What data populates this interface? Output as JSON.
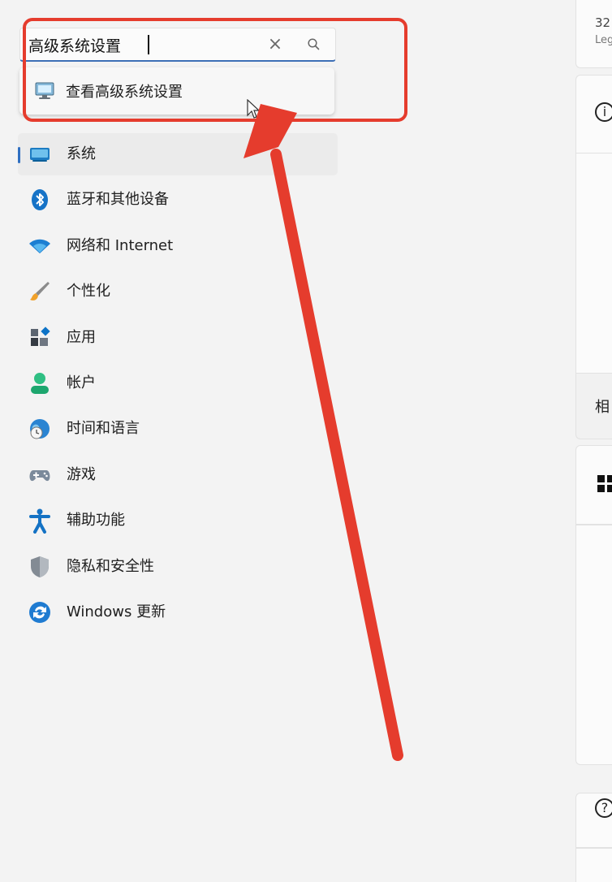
{
  "search": {
    "value": "高级系统设置",
    "placeholder": "",
    "clear_symbol": "×",
    "suggestion": "查看高级系统设置"
  },
  "navigation": {
    "items": [
      {
        "label": "系统",
        "icon": "system-display-icon",
        "active": true
      },
      {
        "label": "蓝牙和其他设备",
        "icon": "bluetooth-icon",
        "active": false
      },
      {
        "label": "网络和 Internet",
        "icon": "wifi-icon",
        "active": false
      },
      {
        "label": "个性化",
        "icon": "brush-icon",
        "active": false
      },
      {
        "label": "应用",
        "icon": "apps-icon",
        "active": false
      },
      {
        "label": "帐户",
        "icon": "account-icon",
        "active": false
      },
      {
        "label": "时间和语言",
        "icon": "time-language-icon",
        "active": false
      },
      {
        "label": "游戏",
        "icon": "gaming-controller-icon",
        "active": false
      },
      {
        "label": "辅助功能",
        "icon": "accessibility-icon",
        "active": false
      },
      {
        "label": "隐私和安全性",
        "icon": "shield-icon",
        "active": false
      },
      {
        "label": "Windows 更新",
        "icon": "windows-update-icon",
        "active": false
      }
    ]
  },
  "right_pane": {
    "top_value": "32",
    "top_subtitle": "Leg",
    "related_heading": "相",
    "info_symbol": "i",
    "help_symbol": "?"
  },
  "colors": {
    "annotation": "#e53c2d",
    "accent": "#2f6fc1"
  }
}
